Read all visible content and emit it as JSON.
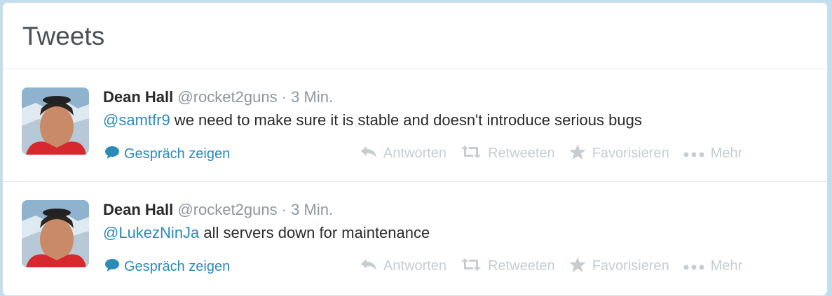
{
  "module": {
    "title": "Tweets"
  },
  "tweets": [
    {
      "name": "Dean Hall",
      "handle": "@rocket2guns",
      "separator": "·",
      "time": "3 Min.",
      "mention": "@samtfr9",
      "text": " we need to make sure it is stable and doesn't introduce serious bugs",
      "conversation": "Gespräch zeigen",
      "actions": {
        "reply": "Antworten",
        "retweet": "Retweeten",
        "favorite": "Favorisieren",
        "more": "Mehr"
      }
    },
    {
      "name": "Dean Hall",
      "handle": "@rocket2guns",
      "separator": "·",
      "time": "3 Min.",
      "mention": "@LukezNinJa",
      "text": " all servers down for maintenance",
      "conversation": "Gespräch zeigen",
      "actions": {
        "reply": "Antworten",
        "retweet": "Retweeten",
        "favorite": "Favorisieren",
        "more": "Mehr"
      }
    }
  ],
  "icons": {
    "conversation": "speech-bubble-icon",
    "reply": "reply-arrow-icon",
    "retweet": "retweet-icon",
    "favorite": "star-icon",
    "more": "more-dots-icon"
  },
  "colors": {
    "background": "#c0deed",
    "link": "#2a8ab8",
    "muted": "#8c979e",
    "action": "#c6cdd1"
  }
}
